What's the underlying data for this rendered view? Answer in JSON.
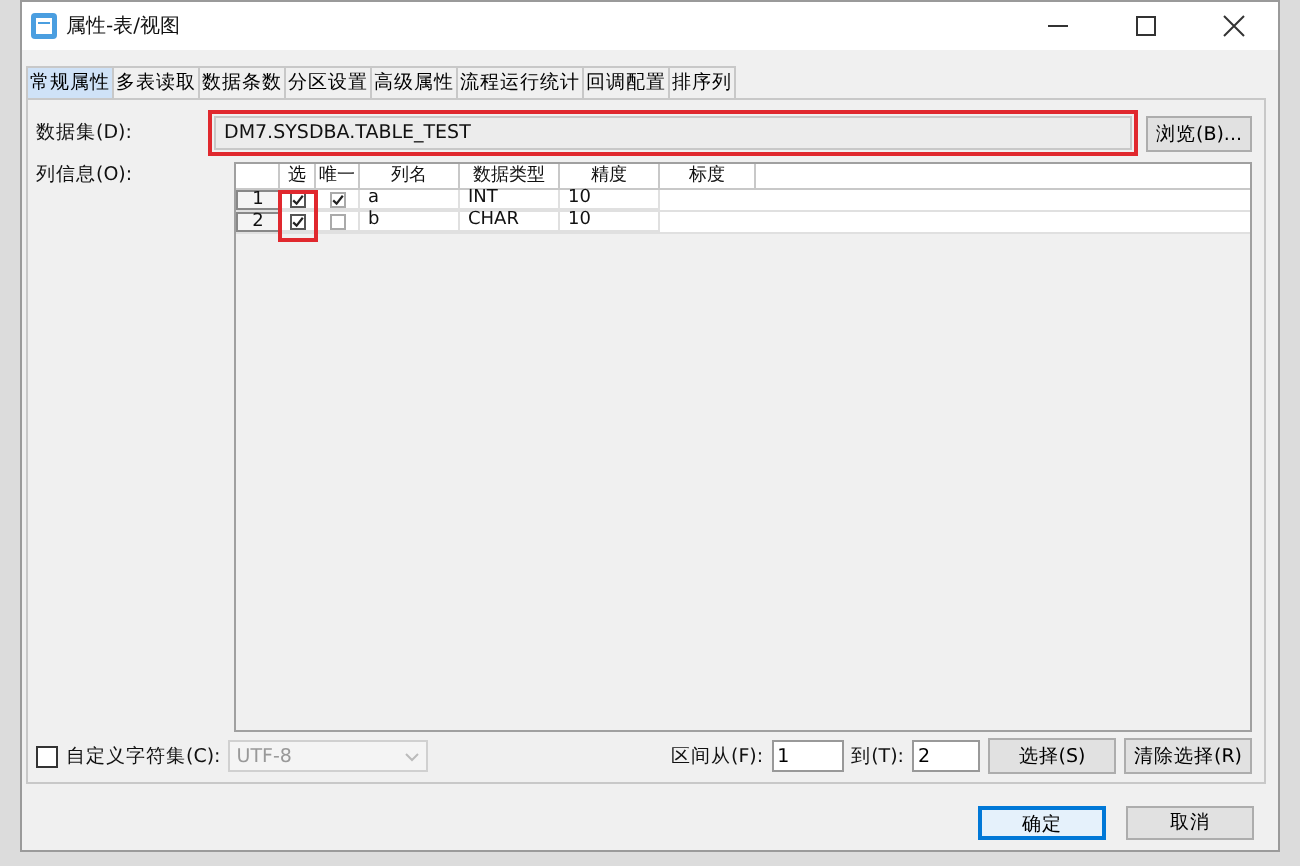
{
  "window": {
    "title": "属性-表/视图"
  },
  "tabs": [
    {
      "label": "常规属性",
      "selected": true
    },
    {
      "label": "多表读取",
      "selected": false
    },
    {
      "label": "数据条数",
      "selected": false
    },
    {
      "label": "分区设置",
      "selected": false
    },
    {
      "label": "高级属性",
      "selected": false
    },
    {
      "label": "流程运行统计",
      "selected": false
    },
    {
      "label": "回调配置",
      "selected": false
    },
    {
      "label": "排序列",
      "selected": false
    }
  ],
  "dataset": {
    "label": "数据集(D):",
    "value": "DM7.SYSDBA.TABLE_TEST",
    "highlighted": true,
    "browse_button": "浏览(B)..."
  },
  "columns_info": {
    "label": "列信息(O):",
    "select_column_highlighted": true,
    "columns": [
      {},
      {
        "label": "选"
      },
      {
        "label": "唯一"
      },
      {
        "label": "列名"
      },
      {
        "label": "数据类型"
      },
      {
        "label": "精度"
      },
      {
        "label": "标度"
      }
    ],
    "rows": [
      {
        "index": "1",
        "selected_col": true,
        "unique": true,
        "name": "a",
        "type": "INT",
        "precision": "10"
      },
      {
        "index": "2",
        "selected_col": true,
        "unique": false,
        "name": "b",
        "type": "CHAR",
        "precision": "10"
      }
    ]
  },
  "charset": {
    "label": "自定义字符集(C):",
    "checked": false,
    "value": "UTF-8",
    "disabled": true
  },
  "range": {
    "from_label": "区间从(F):",
    "from": "1",
    "to_label": "到(T):",
    "to": "2",
    "select_button": "选择(S)",
    "clear_button": "清除选择(R)"
  },
  "buttons": [
    {
      "label": "确定",
      "default": true
    },
    {
      "label": "取消",
      "default": false
    }
  ]
}
